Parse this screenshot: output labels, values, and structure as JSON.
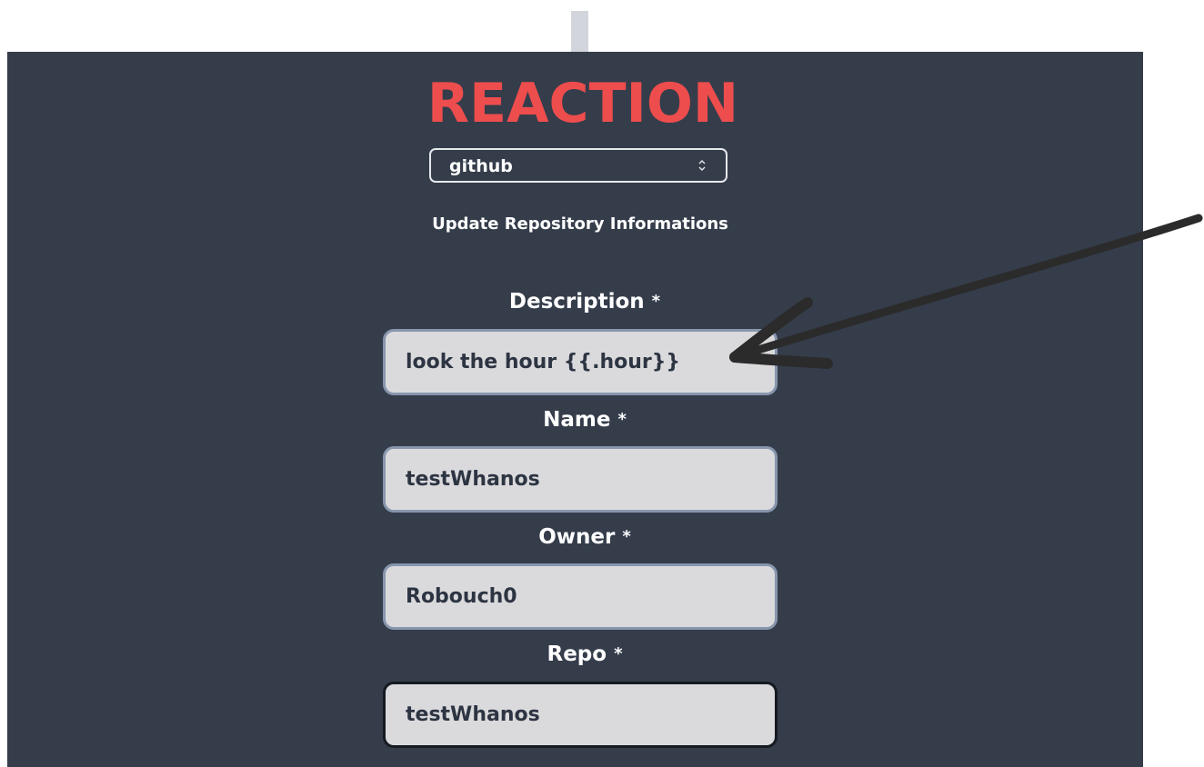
{
  "app": {
    "brand": "REACTION"
  },
  "service_select": {
    "value": "github"
  },
  "action": {
    "title": "Update Repository Informations"
  },
  "fields": [
    {
      "label": "Description",
      "required_mark": "*",
      "value": "look the hour {{.hour}}"
    },
    {
      "label": "Name",
      "required_mark": "*",
      "value": "testWhanos"
    },
    {
      "label": "Owner",
      "required_mark": "*",
      "value": "Robouch0"
    },
    {
      "label": "Repo",
      "required_mark": "*",
      "value": "testWhanos"
    }
  ],
  "colors": {
    "brand": "#ee4d4d",
    "panel": "#353d4b",
    "input_bg": "#dadadd",
    "input_border": "#8796ad",
    "input_border_focused": "#161a21",
    "annotation_arrow": "#2b2b2b"
  },
  "icons": {
    "select_caret": "updown-chevron-icon",
    "annotation": "hand-drawn-arrow-icon"
  }
}
